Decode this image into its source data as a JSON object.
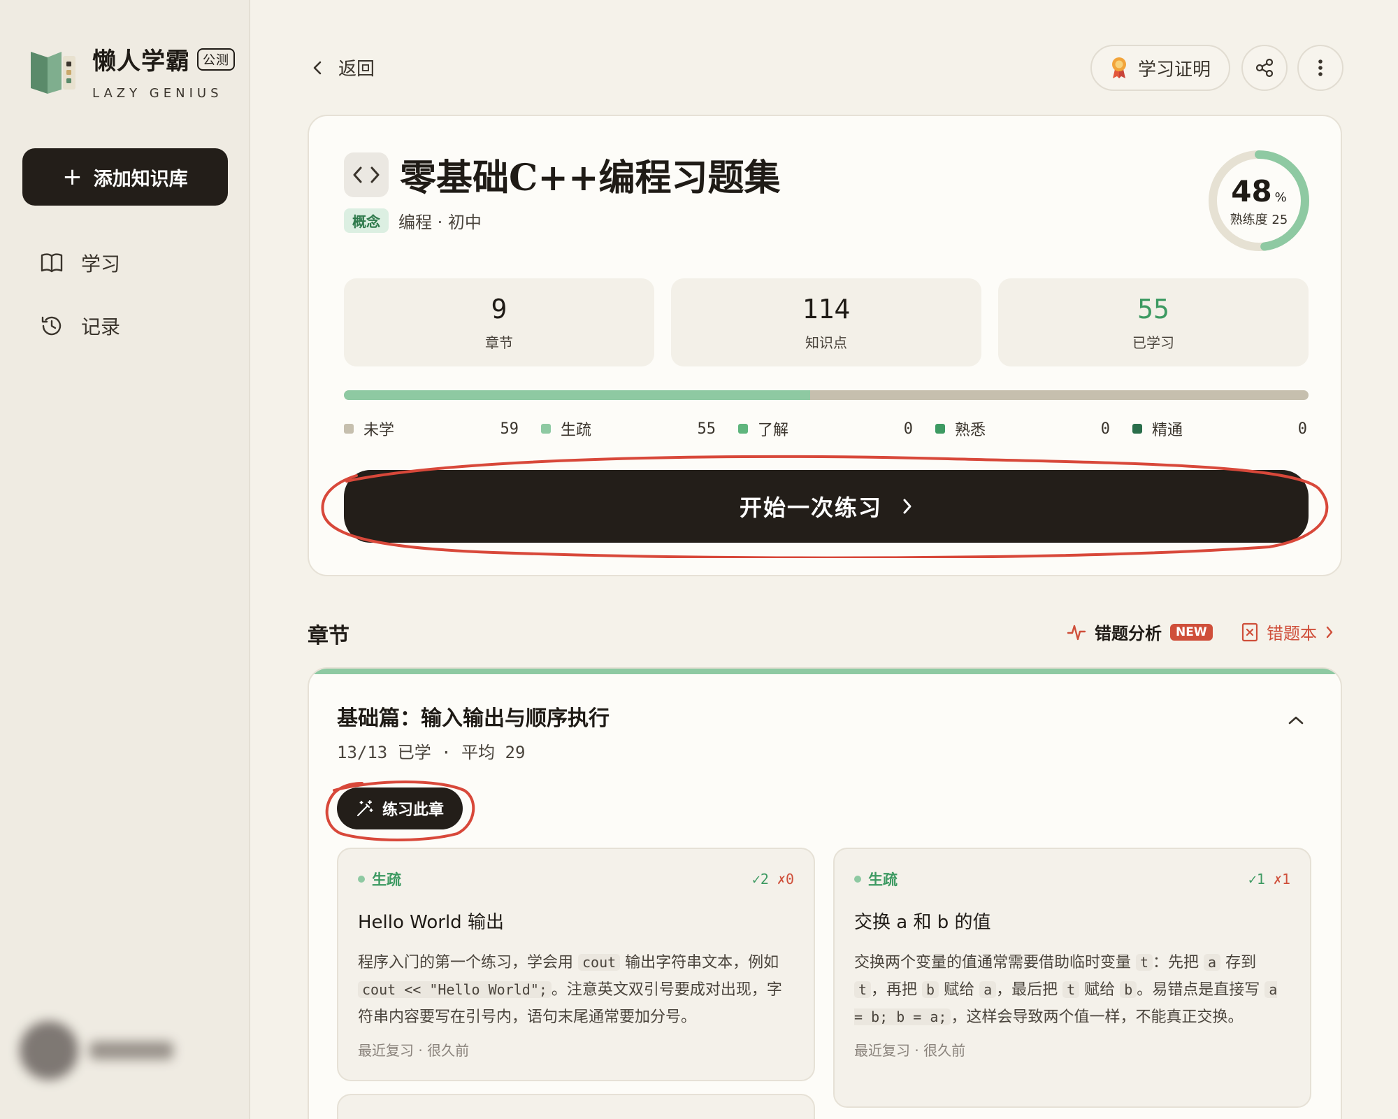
{
  "sidebar": {
    "brand_name": "懒人学霸",
    "brand_badge": "公测",
    "brand_sub": "LAZY GENIUS",
    "add_button": "添加知识库",
    "nav": [
      {
        "label": "学习",
        "icon": "book-icon"
      },
      {
        "label": "记录",
        "icon": "history-icon"
      }
    ]
  },
  "topbar": {
    "back": "返回",
    "certificate": "学习证明"
  },
  "course": {
    "title": "零基础C++编程习题集",
    "tag": "概念",
    "subject": "编程 · 初中",
    "mastery_value": "48",
    "mastery_unit": "%",
    "mastery_label": "熟练度 25",
    "mastery_fraction": 0.48,
    "stats": [
      {
        "value": "9",
        "label": "章节"
      },
      {
        "value": "114",
        "label": "知识点"
      },
      {
        "value": "55",
        "label": "已学习"
      }
    ],
    "progress_fraction": 0.483,
    "legend": [
      {
        "label": "未学",
        "count": "59",
        "color": "#c6bfae"
      },
      {
        "label": "生疏",
        "count": "55",
        "color": "#8ec9a2"
      },
      {
        "label": "了解",
        "count": "0",
        "color": "#5fb57d"
      },
      {
        "label": "熟悉",
        "count": "0",
        "color": "#3d9a62"
      },
      {
        "label": "精通",
        "count": "0",
        "color": "#2a6e4b"
      }
    ],
    "start_button": "开始一次练习"
  },
  "chapters": {
    "heading": "章节",
    "error_analysis": "错题分析",
    "new_badge": "NEW",
    "error_book": "错题本",
    "items": [
      {
        "title": "基础篇：输入输出与顺序执行",
        "meta": "13/13 已学 · 平均 29",
        "practice_button": "练习此章",
        "points": [
          {
            "status": "生疏",
            "correct": "✓2",
            "wrong": "✗0",
            "name": "Hello World 输出",
            "desc_1": "程序入门的第一个练习，学会用 ",
            "code_1": "cout",
            "desc_2": " 输出字符串文本，例如 ",
            "code_2": "cout << \"Hello World\";",
            "desc_3": "。注意英文双引号要成对出现，字符串内容要写在引号内，语句末尾通常要加分号。",
            "review": "最近复习 · 很久前"
          },
          {
            "status": "生疏",
            "correct": "✓1",
            "wrong": "✗1",
            "name": "交换 a 和 b 的值",
            "desc_1": "交换两个变量的值通常需要借助临时变量 ",
            "code_1": "t",
            "desc_2": "：先把 ",
            "code_2": "a",
            "desc_3": " 存到 ",
            "code_3": "t",
            "desc_4": "，再把 ",
            "code_4": "b",
            "desc_5": " 赋给 ",
            "code_5": "a",
            "desc_6": "，最后把 ",
            "code_6": "t",
            "desc_7": " 赋给 ",
            "code_7": "b",
            "desc_8": "。易错点是直接写 ",
            "code_8": "a = b; b = a;",
            "desc_9": "，这样会导致两个值一样，不能真正交换。",
            "review": "最近复习 · 很久前"
          }
        ]
      }
    ]
  },
  "colors": {
    "accent_green": "#8ec9a2",
    "dark": "#231e19",
    "red": "#cf4f3a"
  }
}
